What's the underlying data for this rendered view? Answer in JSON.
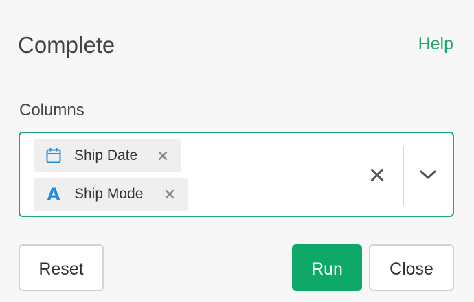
{
  "dialog": {
    "title": "Complete",
    "help_label": "Help"
  },
  "columns_field": {
    "label": "Columns",
    "selected": [
      {
        "label": "Ship Date",
        "type_icon": "calendar-icon",
        "icon_color": "#1d8ee0"
      },
      {
        "label": "Ship Mode",
        "type_icon": "character-type-icon",
        "type_glyph": "A",
        "icon_color": "#1d8ee0"
      }
    ],
    "accent_color": "#1fa86b"
  },
  "footer": {
    "reset_label": "Reset",
    "run_label": "Run",
    "close_label": "Close",
    "run_color": "#0ea968"
  }
}
